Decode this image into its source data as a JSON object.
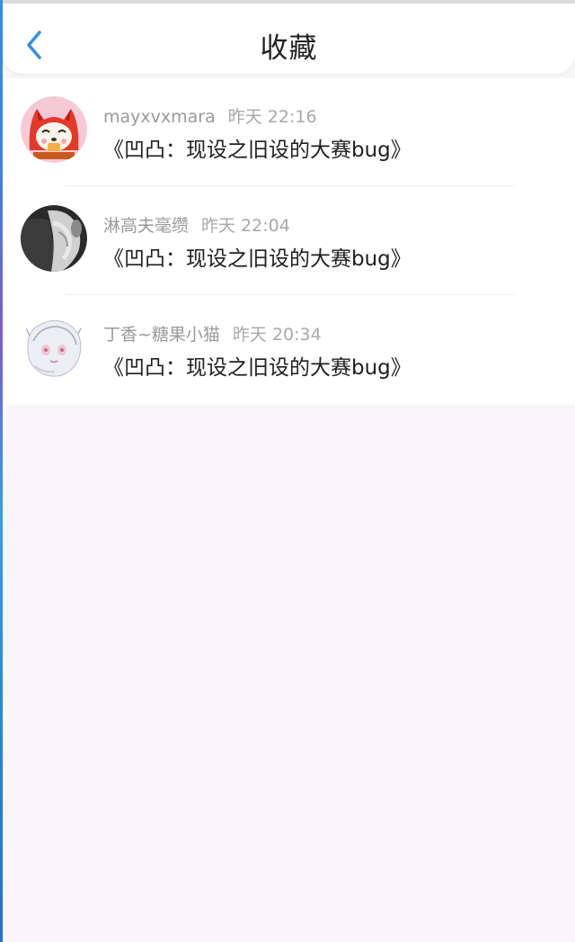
{
  "header": {
    "title": "收藏",
    "back_icon": "chevron-left-icon",
    "accent_color": "#3a8fd8"
  },
  "favorites": [
    {
      "user": "mayxvxmara",
      "time": "昨天 22:16",
      "title": "《凹凸：现设之旧设的大赛bug》"
    },
    {
      "user": "淋高夫毫缵",
      "time": "昨天 22:04",
      "title": "《凹凸：现设之旧设的大赛bug》"
    },
    {
      "user": "丁香~糖果小猫",
      "time": "昨天 20:34",
      "title": "《凹凸：现设之旧设的大赛bug》"
    }
  ]
}
